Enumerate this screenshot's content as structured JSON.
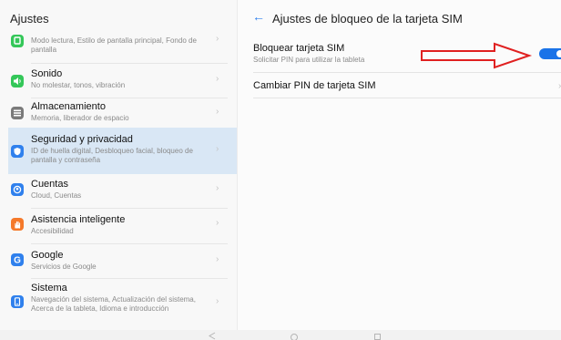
{
  "sidebar": {
    "title": "Ajustes",
    "items": [
      {
        "title": "",
        "subtitle": "Modo lectura, Estilo de pantalla principal, Fondo de pantalla",
        "icon": "display-icon",
        "color": "#34c759"
      },
      {
        "title": "Sonido",
        "subtitle": "No molestar, tonos, vibración",
        "icon": "sound-icon",
        "color": "#34c759"
      },
      {
        "title": "Almacenamiento",
        "subtitle": "Memoria, liberador de espacio",
        "icon": "storage-icon",
        "color": "#7a7a7a"
      },
      {
        "title": "Seguridad y privacidad",
        "subtitle": "ID de huella digital, Desbloqueo facial, bloqueo de pantalla y contraseña",
        "icon": "shield-icon",
        "color": "#2f80ed"
      },
      {
        "title": "Cuentas",
        "subtitle": "Cloud, Cuentas",
        "icon": "account-icon",
        "color": "#2f80ed"
      },
      {
        "title": "Asistencia inteligente",
        "subtitle": "Accesibilidad",
        "icon": "hand-icon",
        "color": "#f5792a"
      },
      {
        "title": "Google",
        "subtitle": "Servicios de Google",
        "icon": "google-icon",
        "color": "#2f80ed"
      },
      {
        "title": "Sistema",
        "subtitle": "Navegación del sistema, Actualización del sistema, Acerca de la tableta, Idioma e introducción",
        "icon": "system-icon",
        "color": "#2f80ed"
      }
    ],
    "chevron": "›"
  },
  "detail": {
    "back_glyph": "←",
    "title": "Ajustes de bloqueo de la tarjeta SIM",
    "lock_sim": {
      "title": "Bloquear tarjeta SIM",
      "subtitle": "Solicitar PIN para utilizar la tableta",
      "enabled": true
    },
    "change_pin": {
      "title": "Cambiar PIN de tarjeta SIM"
    }
  },
  "colors": {
    "accent": "#1a73e8",
    "annotation_arrow": "#e02020"
  }
}
